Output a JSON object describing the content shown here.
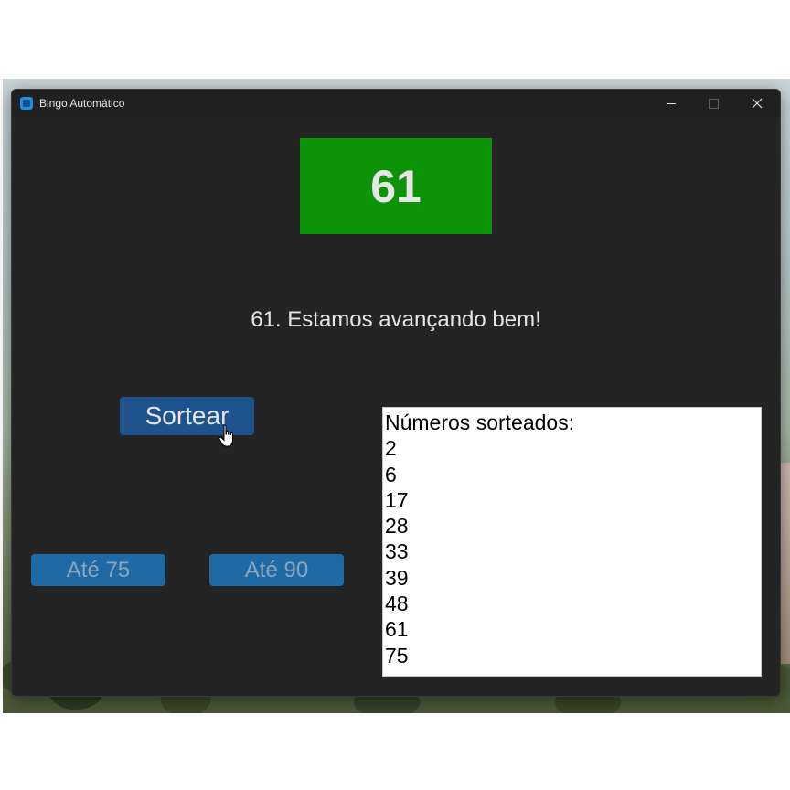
{
  "window": {
    "title": "Bingo Automático"
  },
  "current_number": "61",
  "message": "61. Estamos avançando bem!",
  "buttons": {
    "sortear": "Sortear",
    "ate75": "Até 75",
    "ate90": "Até 90"
  },
  "drawn": {
    "header": "Números sorteados:",
    "items": [
      "2",
      "6",
      "17",
      "28",
      "33",
      "39",
      "48",
      "61",
      "75"
    ]
  },
  "colors": {
    "number_bg": "#0c9307",
    "window_bg": "#242424",
    "primary_button": "#1f538d",
    "secondary_button": "#1f6aa5"
  },
  "icons": {
    "app": "app-icon",
    "minimize": "minimize-icon",
    "maximize": "maximize-icon",
    "close": "close-icon",
    "cursor": "hand-pointer-cursor-icon"
  }
}
